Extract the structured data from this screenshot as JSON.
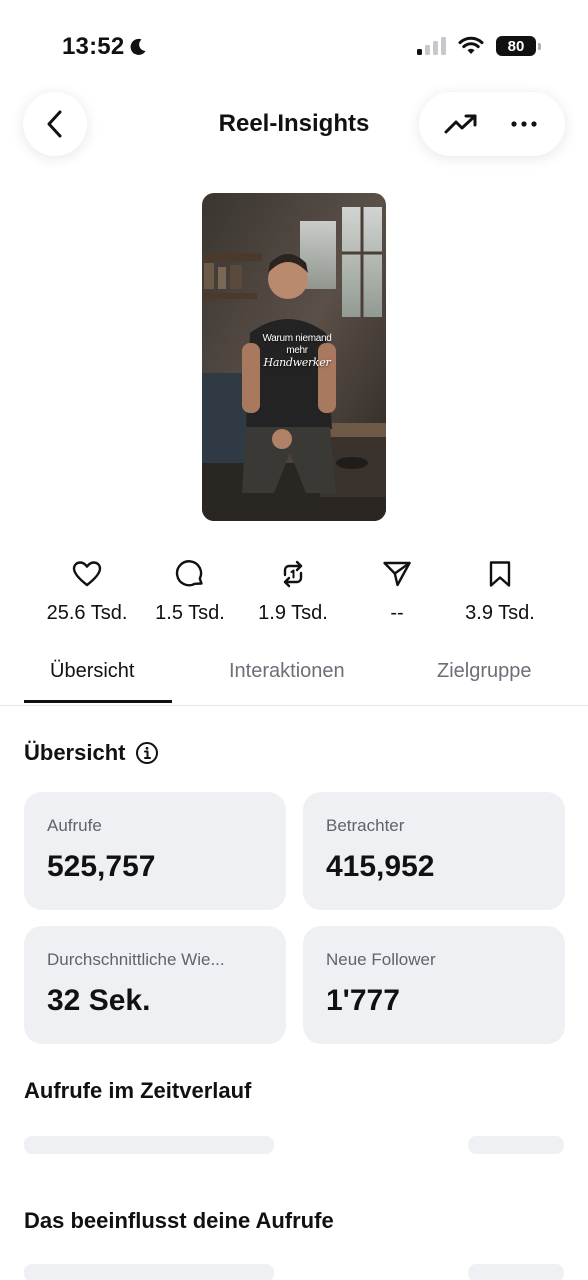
{
  "status_bar": {
    "time": "13:52",
    "battery": "80"
  },
  "header": {
    "title": "Reel-Insights"
  },
  "thumbnail": {
    "caption_line1": "Warum niemand",
    "caption_line2_prefix": "mehr",
    "caption_line2_script": "Handwerker"
  },
  "stats": [
    {
      "icon": "heart-icon",
      "value": "25.6 Tsd."
    },
    {
      "icon": "comment-icon",
      "value": "1.5 Tsd."
    },
    {
      "icon": "repost-icon",
      "value": "1.9 Tsd."
    },
    {
      "icon": "send-icon",
      "value": "--"
    },
    {
      "icon": "bookmark-icon",
      "value": "3.9 Tsd."
    }
  ],
  "tabs": [
    {
      "label": "Übersicht",
      "active": true
    },
    {
      "label": "Interaktionen",
      "active": false
    },
    {
      "label": "Zielgruppe",
      "active": false
    }
  ],
  "overview": {
    "title": "Übersicht",
    "cards": [
      {
        "label": "Aufrufe",
        "value": "525,757"
      },
      {
        "label": "Betrachter",
        "value": "415,952"
      },
      {
        "label": "Durchschnittliche Wie...",
        "value": "32 Sek."
      },
      {
        "label": "Neue Follower",
        "value": "1'777"
      }
    ]
  },
  "sections": {
    "views_over_time": "Aufrufe im Zeitverlauf",
    "influences": "Das beeinflusst deine Aufrufe"
  }
}
